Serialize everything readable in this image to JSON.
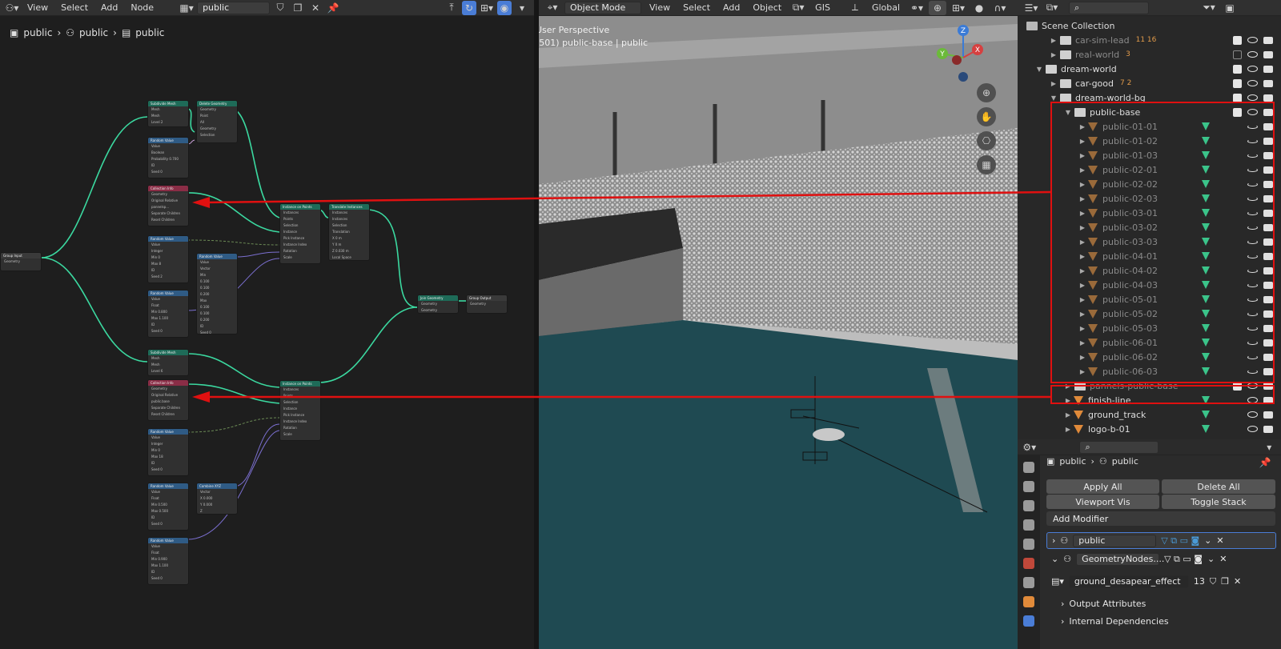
{
  "node_editor": {
    "menus": [
      "View",
      "Select",
      "Add",
      "Node"
    ],
    "tree_name": "public",
    "breadcrumb": [
      "public",
      "public",
      "public"
    ],
    "nodes": [
      {
        "title": "Subdivide Mesh",
        "color": "g",
        "rows": [
          "Mesh",
          "Mesh",
          "Level 2"
        ]
      },
      {
        "title": "Delete Geometry",
        "color": "g",
        "rows": [
          "Geometry",
          "Point",
          "All",
          "Geometry",
          "Selection"
        ]
      },
      {
        "title": "Random Value",
        "color": "b",
        "rows": [
          "Value",
          "Boolean",
          "Probability 0.700",
          "ID",
          "Seed 0"
        ]
      },
      {
        "title": "Collection Info",
        "color": "r",
        "rows": [
          "Geometry",
          "Original  Relative",
          "pannelsp...",
          "Separate Children",
          "Reset Children"
        ]
      },
      {
        "title": "Random Value",
        "color": "b",
        "rows": [
          "Value",
          "Integer",
          "Min 0",
          "Max 8",
          "ID",
          "Seed 2"
        ]
      },
      {
        "title": "Random Value",
        "color": "b",
        "rows": [
          "Value",
          "Vector",
          "Min",
          "0.100",
          "0.100",
          "0.200",
          "Max",
          "0.100",
          "0.100",
          "0.200",
          "ID",
          "Seed 0"
        ]
      },
      {
        "title": "Random Value",
        "color": "b",
        "rows": [
          "Value",
          "Float",
          "Min 0.800",
          "Max 1.100",
          "ID",
          "Seed 0"
        ]
      },
      {
        "title": "Instance on Points",
        "color": "g",
        "rows": [
          "Instances",
          "Points",
          "Selection",
          "Instance",
          "Pick Instance",
          "Instance Index",
          "Rotation",
          "Scale"
        ]
      },
      {
        "title": "Translate Instances",
        "color": "g",
        "rows": [
          "Instances",
          "Instances",
          "Selection",
          "Translation",
          "X 0 m",
          "Y 0 m",
          "Z 0.030 m",
          "Local Space"
        ]
      },
      {
        "title": "Group Input",
        "color": "d",
        "rows": [
          "Geometry"
        ]
      },
      {
        "title": "Join Geometry",
        "color": "g",
        "rows": [
          "Geometry",
          "Geometry"
        ]
      },
      {
        "title": "Group Output",
        "color": "d",
        "rows": [
          "Geometry"
        ]
      },
      {
        "title": "Subdivide Mesh",
        "color": "g",
        "rows": [
          "Mesh",
          "Mesh",
          "Level 6"
        ]
      },
      {
        "title": "Collection Info",
        "color": "r",
        "rows": [
          "Geometry",
          "Original  Relative",
          "public.base",
          "Separate Children",
          "Reset Children"
        ]
      },
      {
        "title": "Instance on Points",
        "color": "g",
        "rows": [
          "Instances",
          "Points",
          "Selection",
          "Instance",
          "Pick Instance",
          "Instance Index",
          "Rotation",
          "Scale"
        ]
      },
      {
        "title": "Random Value",
        "color": "b",
        "rows": [
          "Value",
          "Integer",
          "Min 0",
          "Max 18",
          "ID",
          "Seed 0"
        ]
      },
      {
        "title": "Random Value",
        "color": "b",
        "rows": [
          "Value",
          "Float",
          "Min 0.500",
          "Max 0.500",
          "ID",
          "Seed 0"
        ]
      },
      {
        "title": "Combine XYZ",
        "color": "b",
        "rows": [
          "Vector",
          "X 0.000",
          "Y 0.000",
          "Z"
        ]
      },
      {
        "title": "Random Value",
        "color": "b",
        "rows": [
          "Value",
          "Float",
          "Min 0.900",
          "Max 1.100",
          "ID",
          "Seed 0"
        ]
      }
    ]
  },
  "viewport": {
    "mode": "Object Mode",
    "menus": [
      "View",
      "Select",
      "Add",
      "Object",
      "GIS"
    ],
    "transform": "Global",
    "perspective": "User Perspective",
    "active_info": "(501) public-base | public",
    "gizmo": {
      "x": "X",
      "y": "Y",
      "z": "Z"
    }
  },
  "outliner": {
    "title": "Scene Collection",
    "rows": [
      {
        "name": "car-sim-lead",
        "dim": true,
        "badge": "11 16"
      },
      {
        "name": "real-world",
        "dim": true,
        "badge": "3"
      },
      {
        "name": "dream-world",
        "dim": false
      },
      {
        "name": "car-good",
        "dim": false,
        "badge": "7 2"
      },
      {
        "name": "dream-world-bg",
        "dim": false
      },
      {
        "name": "public-base",
        "dim": false
      },
      {
        "name": "public-01-01",
        "dim": true
      },
      {
        "name": "public-01-02",
        "dim": true
      },
      {
        "name": "public-01-03",
        "dim": true
      },
      {
        "name": "public-02-01",
        "dim": true
      },
      {
        "name": "public-02-02",
        "dim": true
      },
      {
        "name": "public-02-03",
        "dim": true
      },
      {
        "name": "public-03-01",
        "dim": true
      },
      {
        "name": "public-03-02",
        "dim": true
      },
      {
        "name": "public-03-03",
        "dim": true
      },
      {
        "name": "public-04-01",
        "dim": true
      },
      {
        "name": "public-04-02",
        "dim": true
      },
      {
        "name": "public-04-03",
        "dim": true
      },
      {
        "name": "public-05-01",
        "dim": true
      },
      {
        "name": "public-05-02",
        "dim": true
      },
      {
        "name": "public-05-03",
        "dim": true
      },
      {
        "name": "public-06-01",
        "dim": true
      },
      {
        "name": "public-06-02",
        "dim": true
      },
      {
        "name": "public-06-03",
        "dim": true
      },
      {
        "name": "pannels-public-base",
        "dim": true
      },
      {
        "name": "finish-line",
        "dim": false
      },
      {
        "name": "ground_track",
        "dim": false
      },
      {
        "name": "logo-b-01",
        "dim": false
      }
    ]
  },
  "properties": {
    "breadcrumb": [
      "public",
      "public"
    ],
    "apply_all": "Apply All",
    "delete_all": "Delete All",
    "viewport_vis": "Viewport Vis",
    "toggle_stack": "Toggle Stack",
    "add_modifier": "Add Modifier",
    "modifier1": "public",
    "modifier2": "GeometryNodes....",
    "node_group": "ground_desapear_effect",
    "node_group_users": "13",
    "output_attributes": "Output Attributes",
    "internal_dependencies": "Internal Dependencies"
  },
  "colors": {
    "accent": "#4a7dd6",
    "highlight": "#e01010",
    "socket_green": "#3bd9a0"
  }
}
